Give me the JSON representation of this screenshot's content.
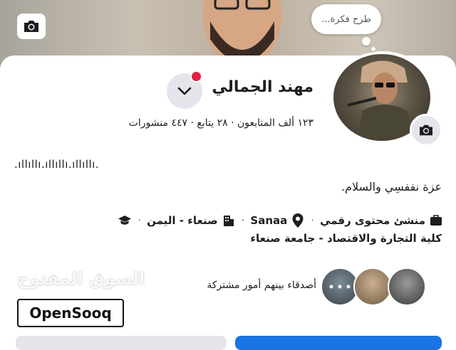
{
  "profile": {
    "name": "مهند الجمالي",
    "stats": "١٢٣ ألف المتابعون · ٢٨ يتابع · ٤٤٧ منشورات"
  },
  "composer": {
    "bubble_text": "طرح فكرة..."
  },
  "bio": {
    "bars": ".ıllıllı.ıllıllı.ıllıllı.",
    "text": "عزة نففسِي والسلام."
  },
  "info": {
    "category": "منشئ محتوى رقمي",
    "location_city": "Sanaa",
    "location_region": "صنعاء - اليمن",
    "education": "كلية التجارة والاقتصاد - جامعة صنعاء"
  },
  "friends": {
    "text": "أصدقاء بينهم أمور مشتركة"
  },
  "watermark": {
    "arabic": "السوق المفتوح",
    "english": "OpenSooq"
  },
  "icons": [
    "camera-icon",
    "chevron-down-icon",
    "briefcase-icon",
    "location-pin-icon",
    "building-icon",
    "graduation-cap-icon"
  ],
  "colors": {
    "primary": "#1b74e4",
    "notification": "#e41e3f",
    "button_gray": "#e4e6eb"
  }
}
